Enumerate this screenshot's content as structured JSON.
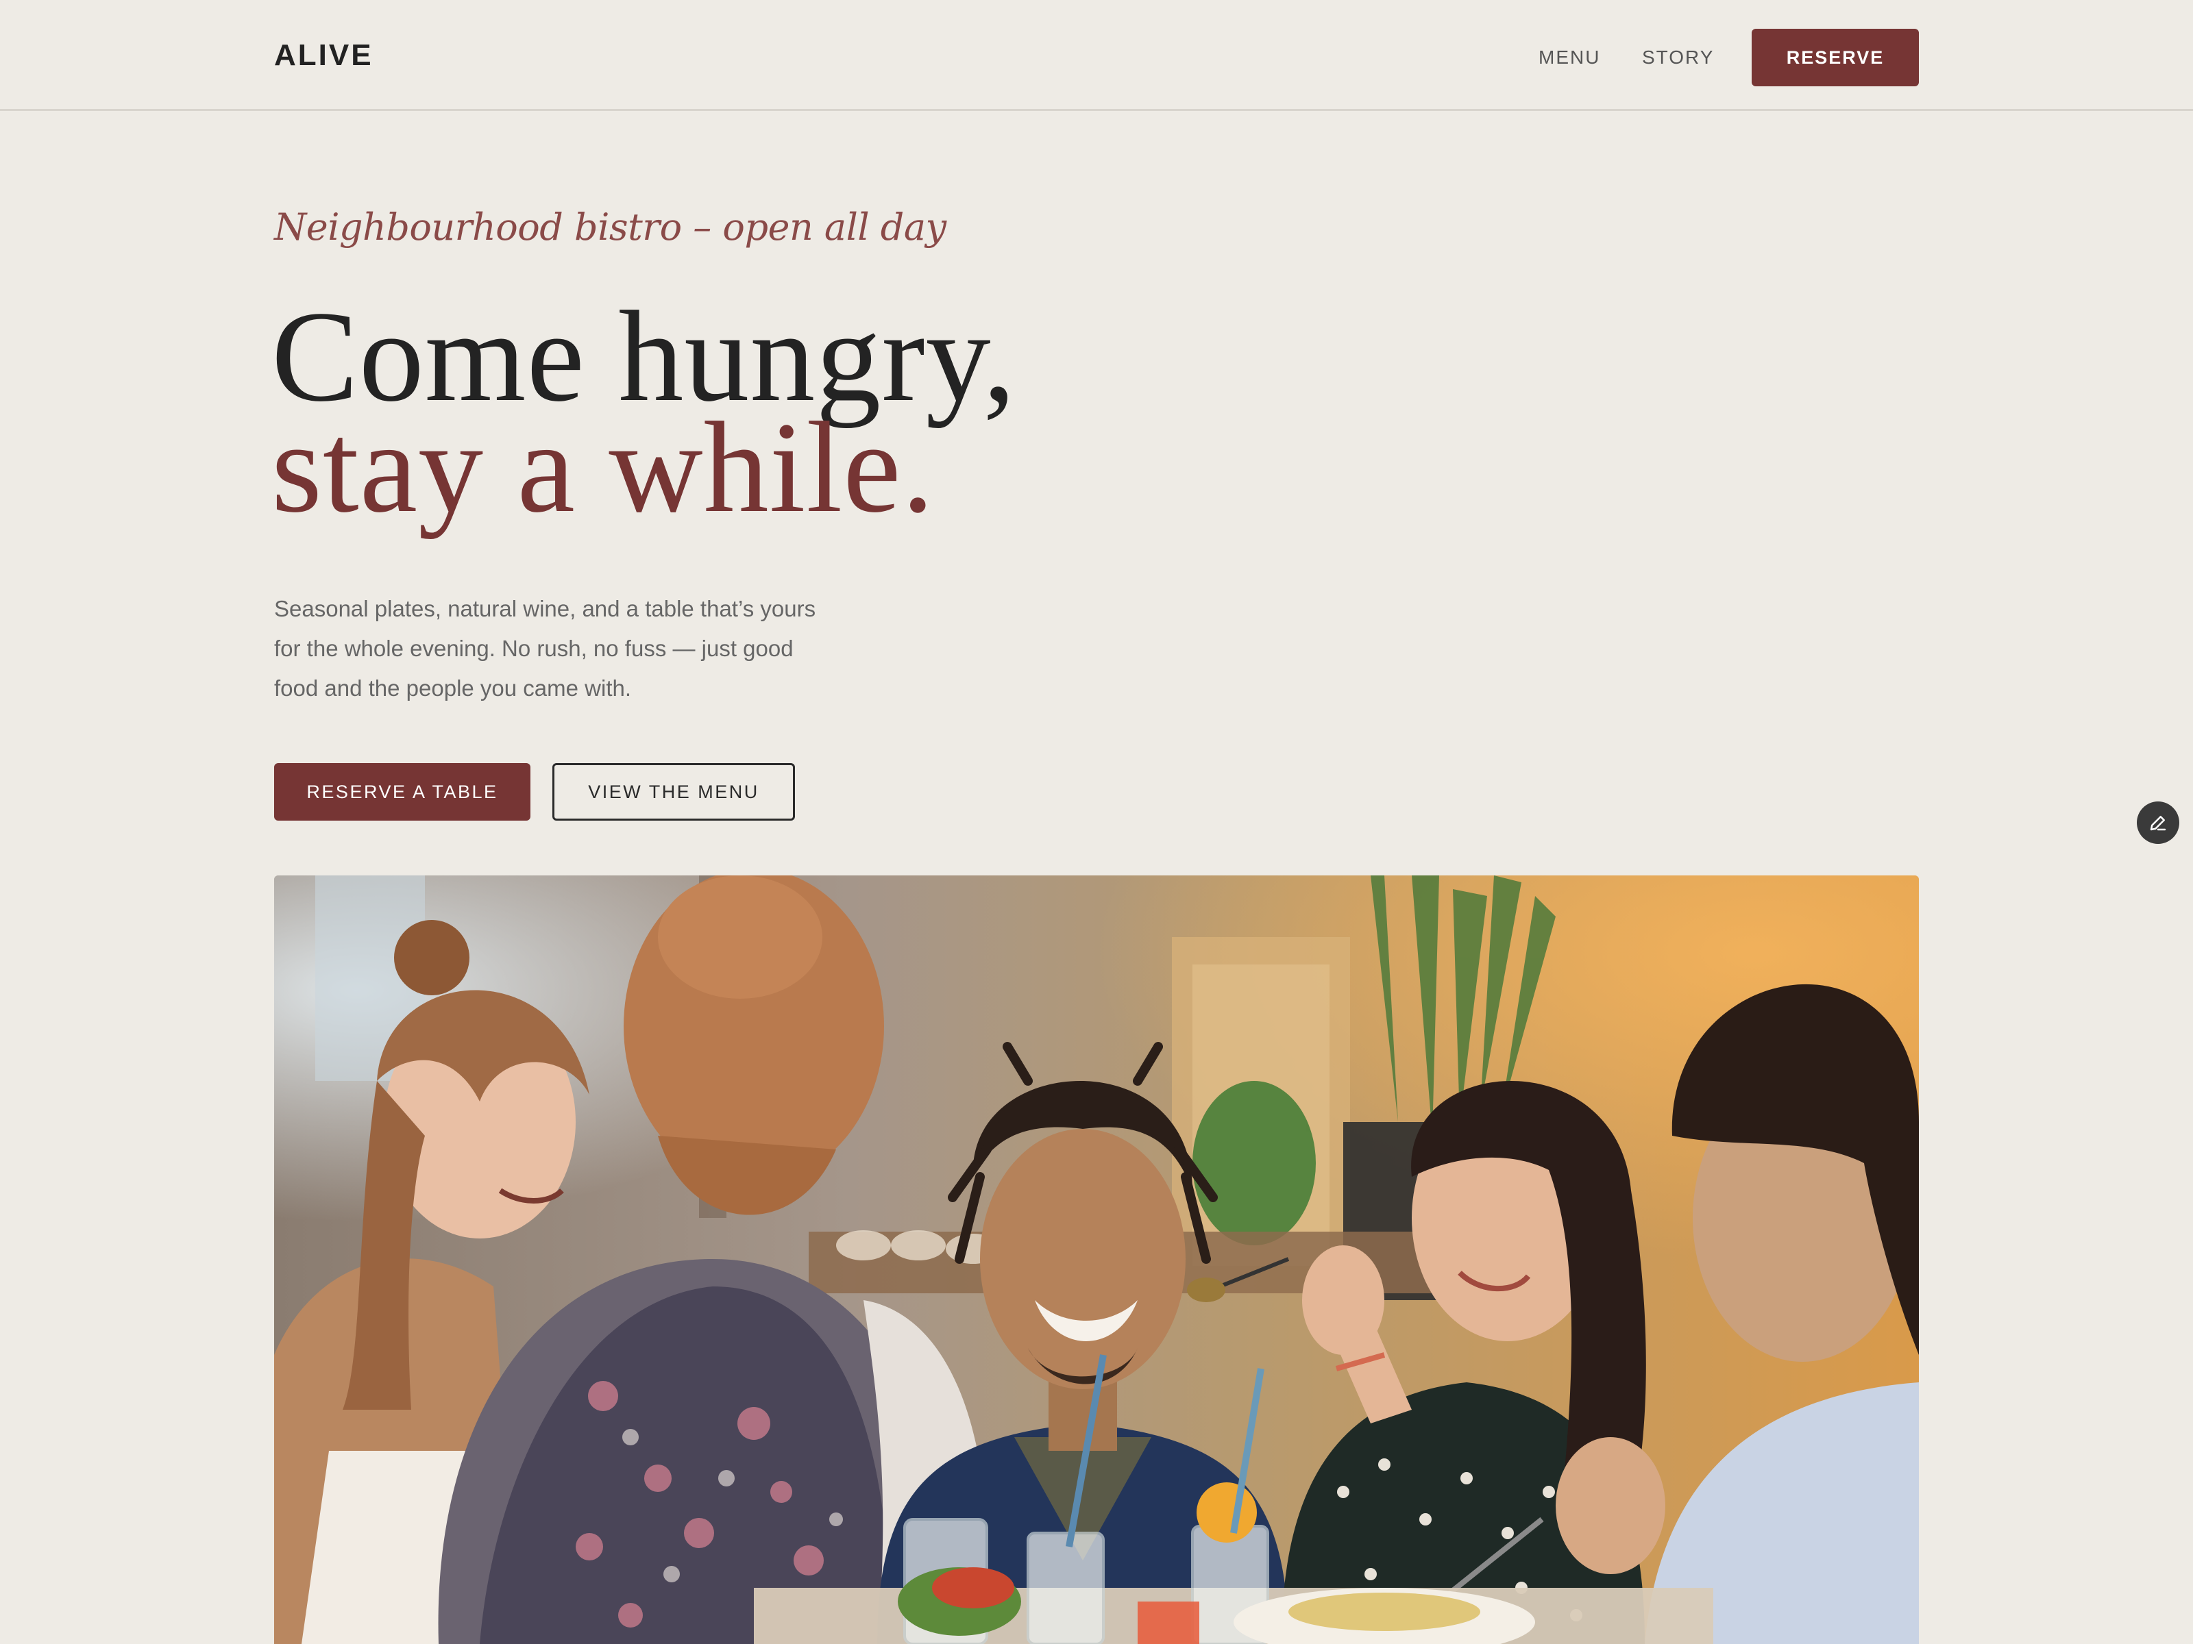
{
  "header": {
    "logo": "ALIVE",
    "nav": {
      "menu": "MENU",
      "story": "STORY",
      "reserve": "RESERVE"
    }
  },
  "hero": {
    "tagline": "Neighbourhood bistro – open all day",
    "headline_line1": "Come hungry,",
    "headline_line2": "stay a while.",
    "lede": "Seasonal plates, natural wine, and a table that’s yours for the whole evening. No rush, no fuss — just good food and the people you came with.",
    "primary_cta": "RESERVE A TABLE",
    "secondary_cta": "VIEW THE MENU"
  },
  "colors": {
    "background": "#eeebe5",
    "accent": "#763534",
    "text": "#232323",
    "muted": "#666666"
  },
  "icons": {
    "edit": "pencil-icon"
  }
}
